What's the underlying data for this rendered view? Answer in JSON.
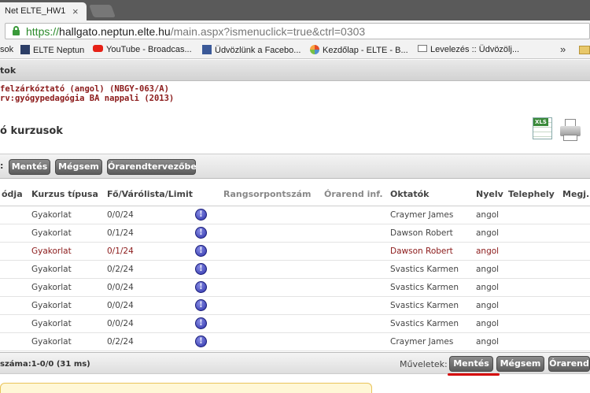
{
  "browser": {
    "tab_title": "Net ELTE_HW1",
    "tab_close": "×",
    "url_scheme": "https://",
    "url_host": "hallgato.neptun.elte.hu",
    "url_path": "/main.aspx?ismenuclick=true&ctrl=0303"
  },
  "bookmarks": {
    "items": [
      "sok",
      "ELTE Neptun",
      "YouTube - Broadcas...",
      "Üdvözlünk a Facebo...",
      "Kezdőlap - ELTE - B...",
      "Levelezés :: Üdvözölj..."
    ],
    "more": "»"
  },
  "page": {
    "section_header": "tok",
    "subject_line1": "felzárkóztató (angol) (NBGY-063/A)",
    "subject_line2": "rv:gyógypedagógia BA nappali (2013)",
    "title": "ó kurzusok",
    "xls_label": "XLS"
  },
  "toolbar_top": {
    "label": ":",
    "save": "Mentés",
    "cancel": "Mégsem",
    "planner": "Órarendtervezőbe"
  },
  "table": {
    "headers": {
      "code": "ódja",
      "type": "Kurzus típusa",
      "count": "Fő/Várólista/Limit",
      "rank": "Rangsorpontszám",
      "schedule": "Órarend inf.",
      "teachers": "Oktatók",
      "lang": "Nyelv",
      "site": "Telephely",
      "note": "Megj."
    },
    "info_glyph": "!",
    "rows": [
      {
        "type": "Gyakorlat",
        "count": "0/0/24",
        "teacher": "Craymer James",
        "lang": "angol"
      },
      {
        "type": "Gyakorlat",
        "count": "0/1/24",
        "teacher": "Dawson Robert",
        "lang": "angol"
      },
      {
        "type": "Gyakorlat",
        "count": "0/1/24",
        "teacher": "Dawson Robert",
        "lang": "angol"
      },
      {
        "type": "Gyakorlat",
        "count": "0/2/24",
        "teacher": "Svastics Karmen",
        "lang": "angol"
      },
      {
        "type": "Gyakorlat",
        "count": "0/0/24",
        "teacher": "Svastics Karmen",
        "lang": "angol"
      },
      {
        "type": "Gyakorlat",
        "count": "0/0/24",
        "teacher": "Svastics Karmen",
        "lang": "angol"
      },
      {
        "type": "Gyakorlat",
        "count": "0/0/24",
        "teacher": "Svastics Karmen",
        "lang": "angol"
      },
      {
        "type": "Gyakorlat",
        "count": "0/2/24",
        "teacher": "Craymer James",
        "lang": "angol"
      }
    ]
  },
  "footer": {
    "count_text": "száma:1-0/0 (31 ms)",
    "ops_label": "Műveletek:",
    "save": "Mentés",
    "cancel": "Mégsem",
    "schedule": "Órarend"
  },
  "colors": {
    "accent_red": "#8b1a1a",
    "highlight_underline": "#d40000",
    "button_gray": "#5c5c5c"
  }
}
